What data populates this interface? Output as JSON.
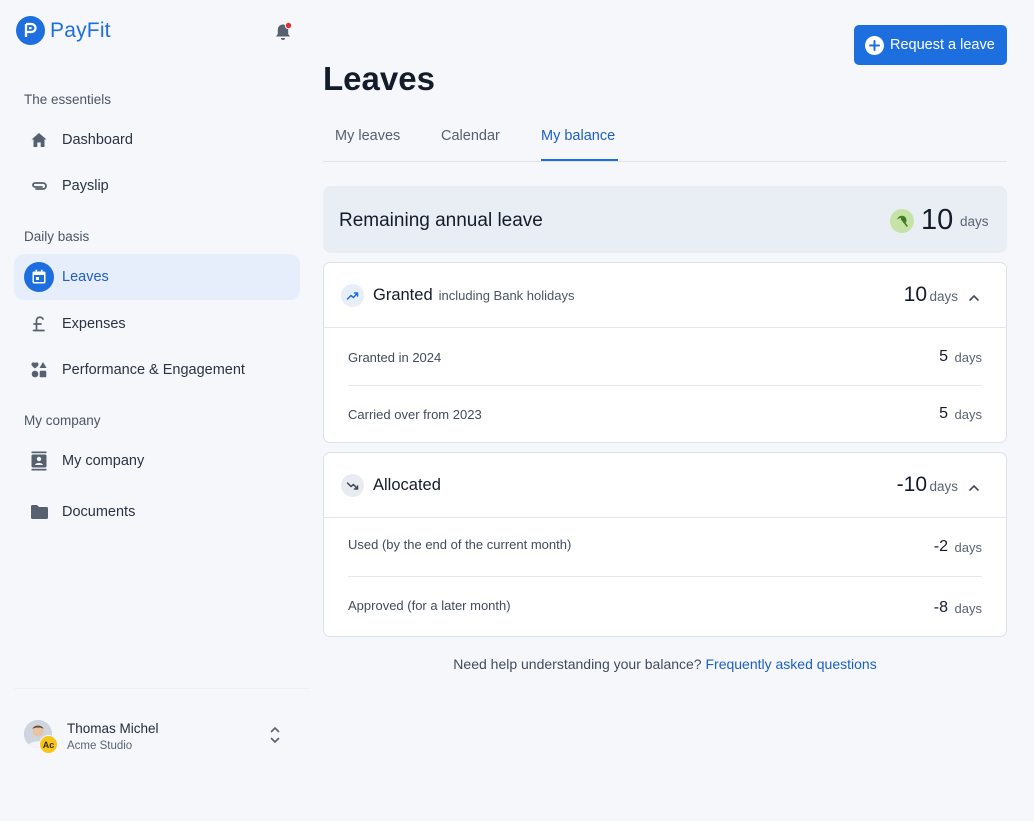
{
  "brand": {
    "name": "PayFit",
    "color": "#1d6fe0"
  },
  "notifications": {
    "icon": "bell-icon",
    "has_unread": true
  },
  "sidebar": {
    "sections": [
      {
        "label": "The essentiels"
      },
      {
        "label": "Daily basis"
      },
      {
        "label": "My company"
      }
    ],
    "items": [
      {
        "label": "Dashboard",
        "icon": "home-icon"
      },
      {
        "label": "Payslip",
        "icon": "paperclip-icon"
      },
      {
        "label": "Leaves",
        "icon": "calendar-icon",
        "active": true
      },
      {
        "label": "Expenses",
        "icon": "pound-icon"
      },
      {
        "label": "Performance & Engagement",
        "icon": "shapes-icon"
      },
      {
        "label": "My company",
        "icon": "contact-card-icon"
      },
      {
        "label": "Documents",
        "icon": "folder-icon"
      }
    ]
  },
  "user": {
    "name": "Thomas Michel",
    "org": "Acme Studio",
    "badge": "Ac"
  },
  "header": {
    "title": "Leaves",
    "request_button": "Request a leave"
  },
  "tabs": [
    {
      "label": "My leaves"
    },
    {
      "label": "Calendar"
    },
    {
      "label": "My balance",
      "active": true
    }
  ],
  "balance": {
    "remaining": {
      "title": "Remaining annual leave",
      "value": "10",
      "unit": "days"
    },
    "granted": {
      "title": "Granted",
      "subtitle": "including Bank holidays",
      "value": "10",
      "unit": "days",
      "rows": [
        {
          "label": "Granted in 2024",
          "value": "5",
          "unit": "days"
        },
        {
          "label": "Carried over from 2023",
          "value": "5",
          "unit": "days"
        }
      ]
    },
    "allocated": {
      "title": "Allocated",
      "value": "-10",
      "unit": "days",
      "rows": [
        {
          "label": "Used (by the end of the current month)",
          "value": "-2",
          "unit": "days"
        },
        {
          "label": "Approved (for a later month)",
          "value": "-8",
          "unit": "days"
        }
      ]
    }
  },
  "help": {
    "text": "Need help understanding your balance?",
    "link": "Frequently asked questions"
  }
}
